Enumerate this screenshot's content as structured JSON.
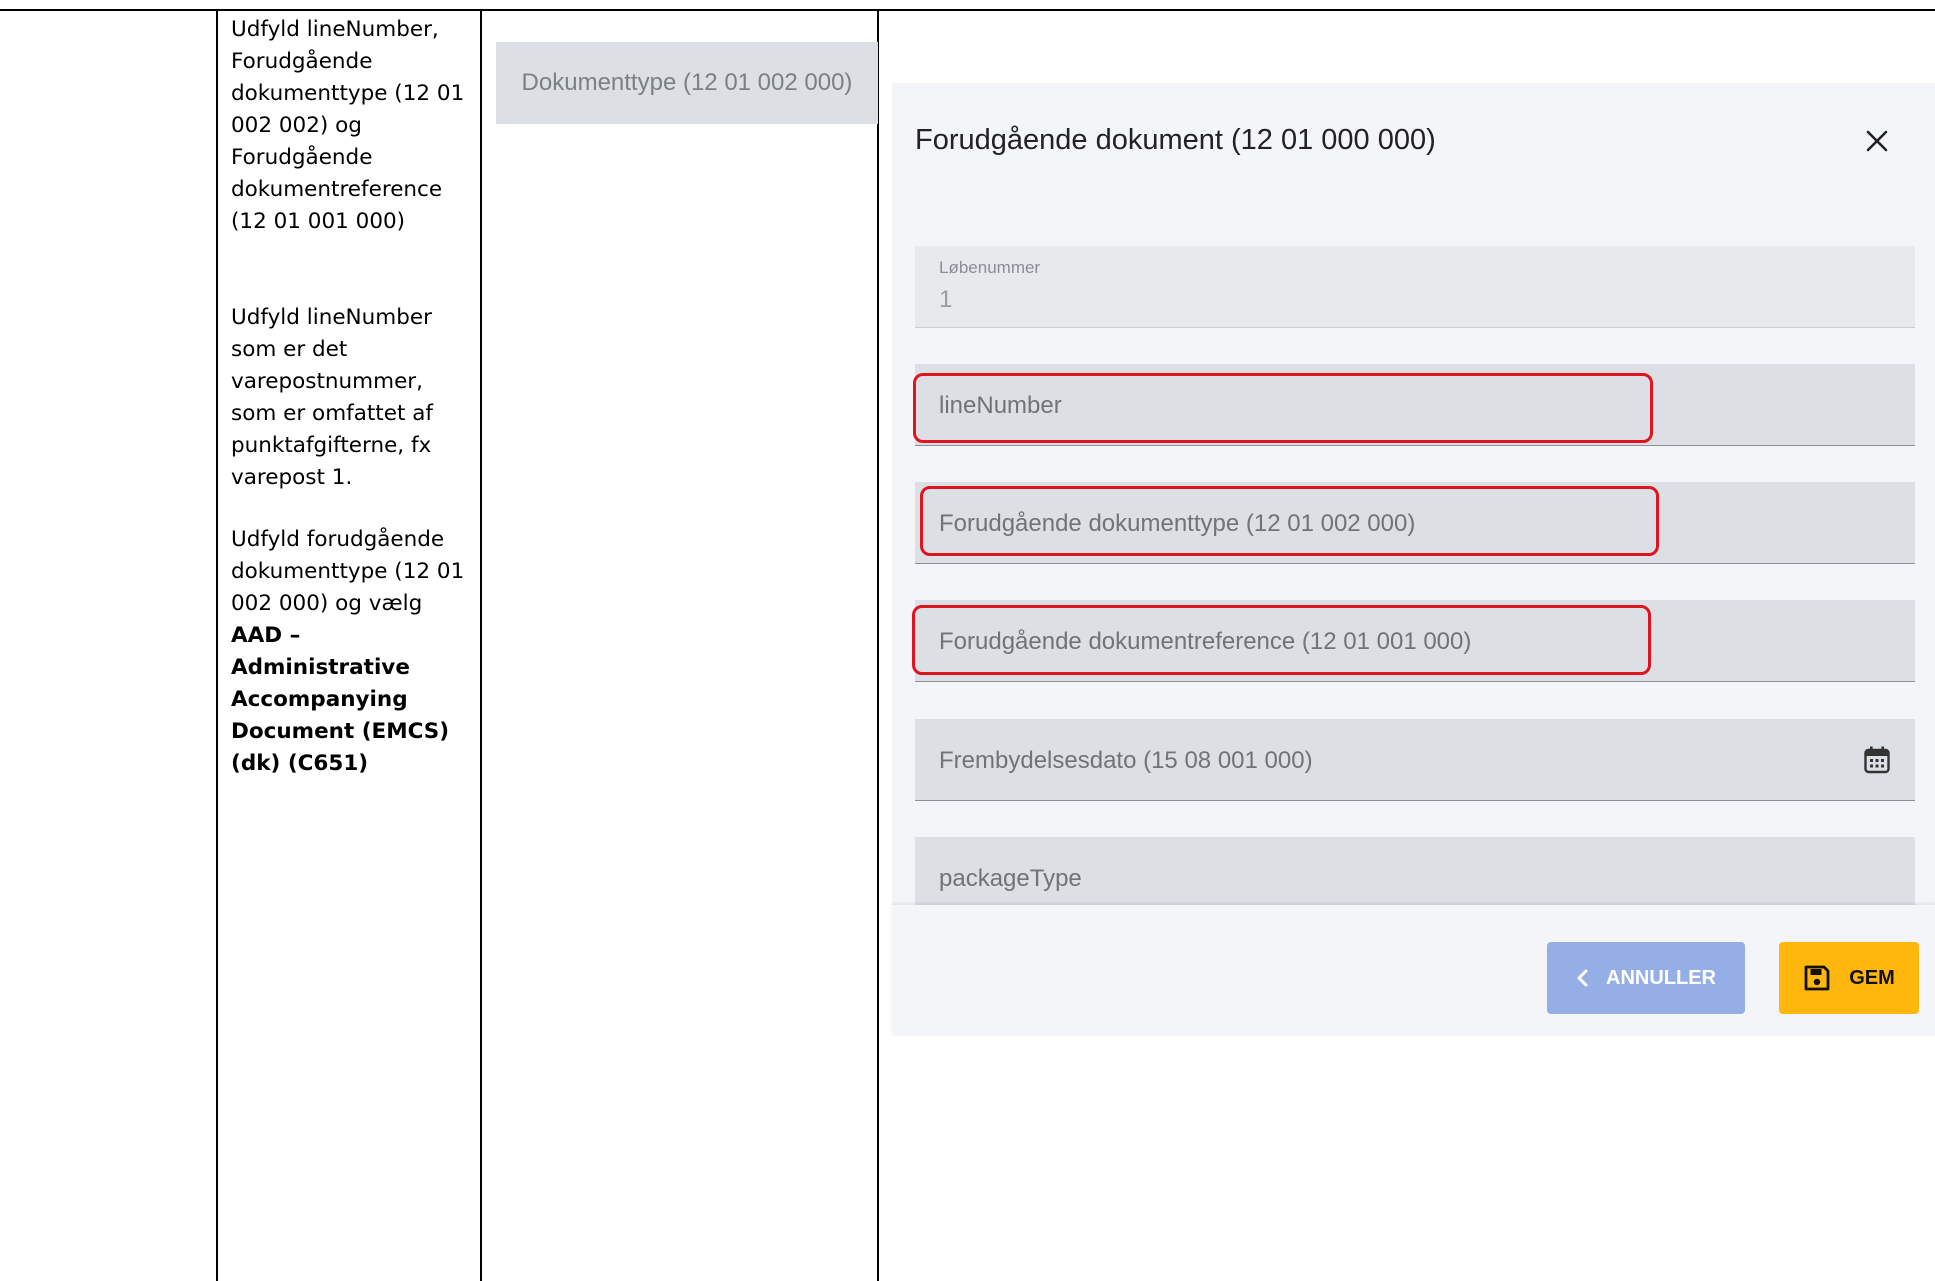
{
  "instructions": {
    "para1": "Udfyld lineNumber, Forudgående dokumenttype (12 01 002 002) og Forudgående dokumentreference (12 01 001 000)",
    "para2": "Udfyld lineNumber som er det varepostnummer, som er omfattet af punktafgifterne, fx varepost 1.",
    "para3_plain": "Udfyld forudgående dokumenttype (12 01 002 000) og vælg",
    "para3_bold": "AAD – Administrative Accompanying Document (EMCS) (dk) (C651)"
  },
  "doc_type_button": "Dokumenttype (12 01 002 000)",
  "dialog": {
    "title": "Forudgående dokument (12 01 000 000)",
    "fields": {
      "lobenummer_label": "Løbenummer",
      "lobenummer_value": "1",
      "line_number": "lineNumber",
      "document_type": "Forudgående dokumenttype (12 01 002 000)",
      "document_reference": "Forudgående dokumentreference (12 01 001 000)",
      "presentation_date": "Frembydelsesdato (15 08 001 000)",
      "package_type": "packageType"
    },
    "buttons": {
      "cancel": "ANNULLER",
      "save": "GEM"
    }
  },
  "colors": {
    "highlight": "#e0141e",
    "save_button": "#ffb60d",
    "cancel_button": "#95afe6"
  },
  "icons": [
    "close-icon",
    "calendar-icon",
    "chevron-left-icon",
    "floppy-disk-icon"
  ]
}
